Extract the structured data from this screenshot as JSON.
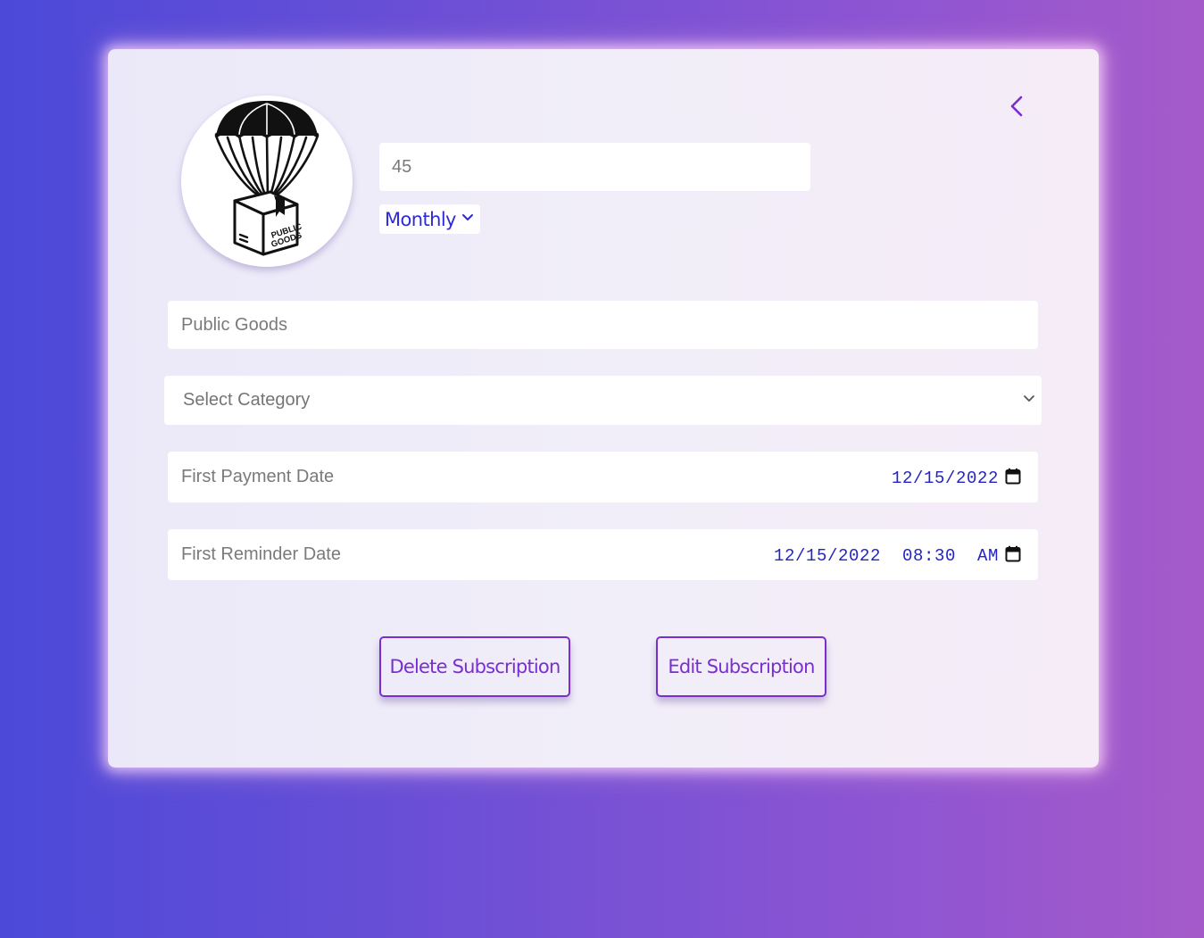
{
  "subscription": {
    "logo_icon": "parachute-box-logo",
    "logo_text": [
      "PUBLIC",
      "GOODS"
    ],
    "amount": "45",
    "frequency": "Monthly",
    "name": "Public Goods",
    "category_placeholder": "Select Category",
    "first_payment": {
      "label": "First Payment Date",
      "value": "12/15/2022"
    },
    "first_reminder": {
      "label": "First Reminder Date",
      "value": "12/15/2022  08:30  AM"
    }
  },
  "actions": {
    "back_icon": "chevron-left-icon",
    "delete_label": "Delete Subscription",
    "edit_label": "Edit Subscription"
  },
  "colors": {
    "accent": "#7b2ed0",
    "date_text": "#2323c8",
    "frequency_text": "#2d2ad6"
  }
}
